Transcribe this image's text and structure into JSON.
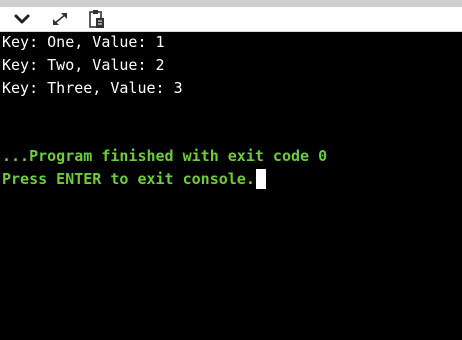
{
  "toolbar": {
    "icons": [
      "chevron-down-icon",
      "expand-icon",
      "clipboard-icon"
    ]
  },
  "console": {
    "output_lines": [
      "Key: One, Value: 1",
      "Key: Two, Value: 2",
      "Key: Three, Value: 3"
    ],
    "finished_message": "...Program finished with exit code 0",
    "exit_prompt": "Press ENTER to exit console."
  },
  "colors": {
    "background": "#000000",
    "output_text": "#ffffff",
    "status_text": "#6ccd3c",
    "toolbar": "#ffffff"
  }
}
